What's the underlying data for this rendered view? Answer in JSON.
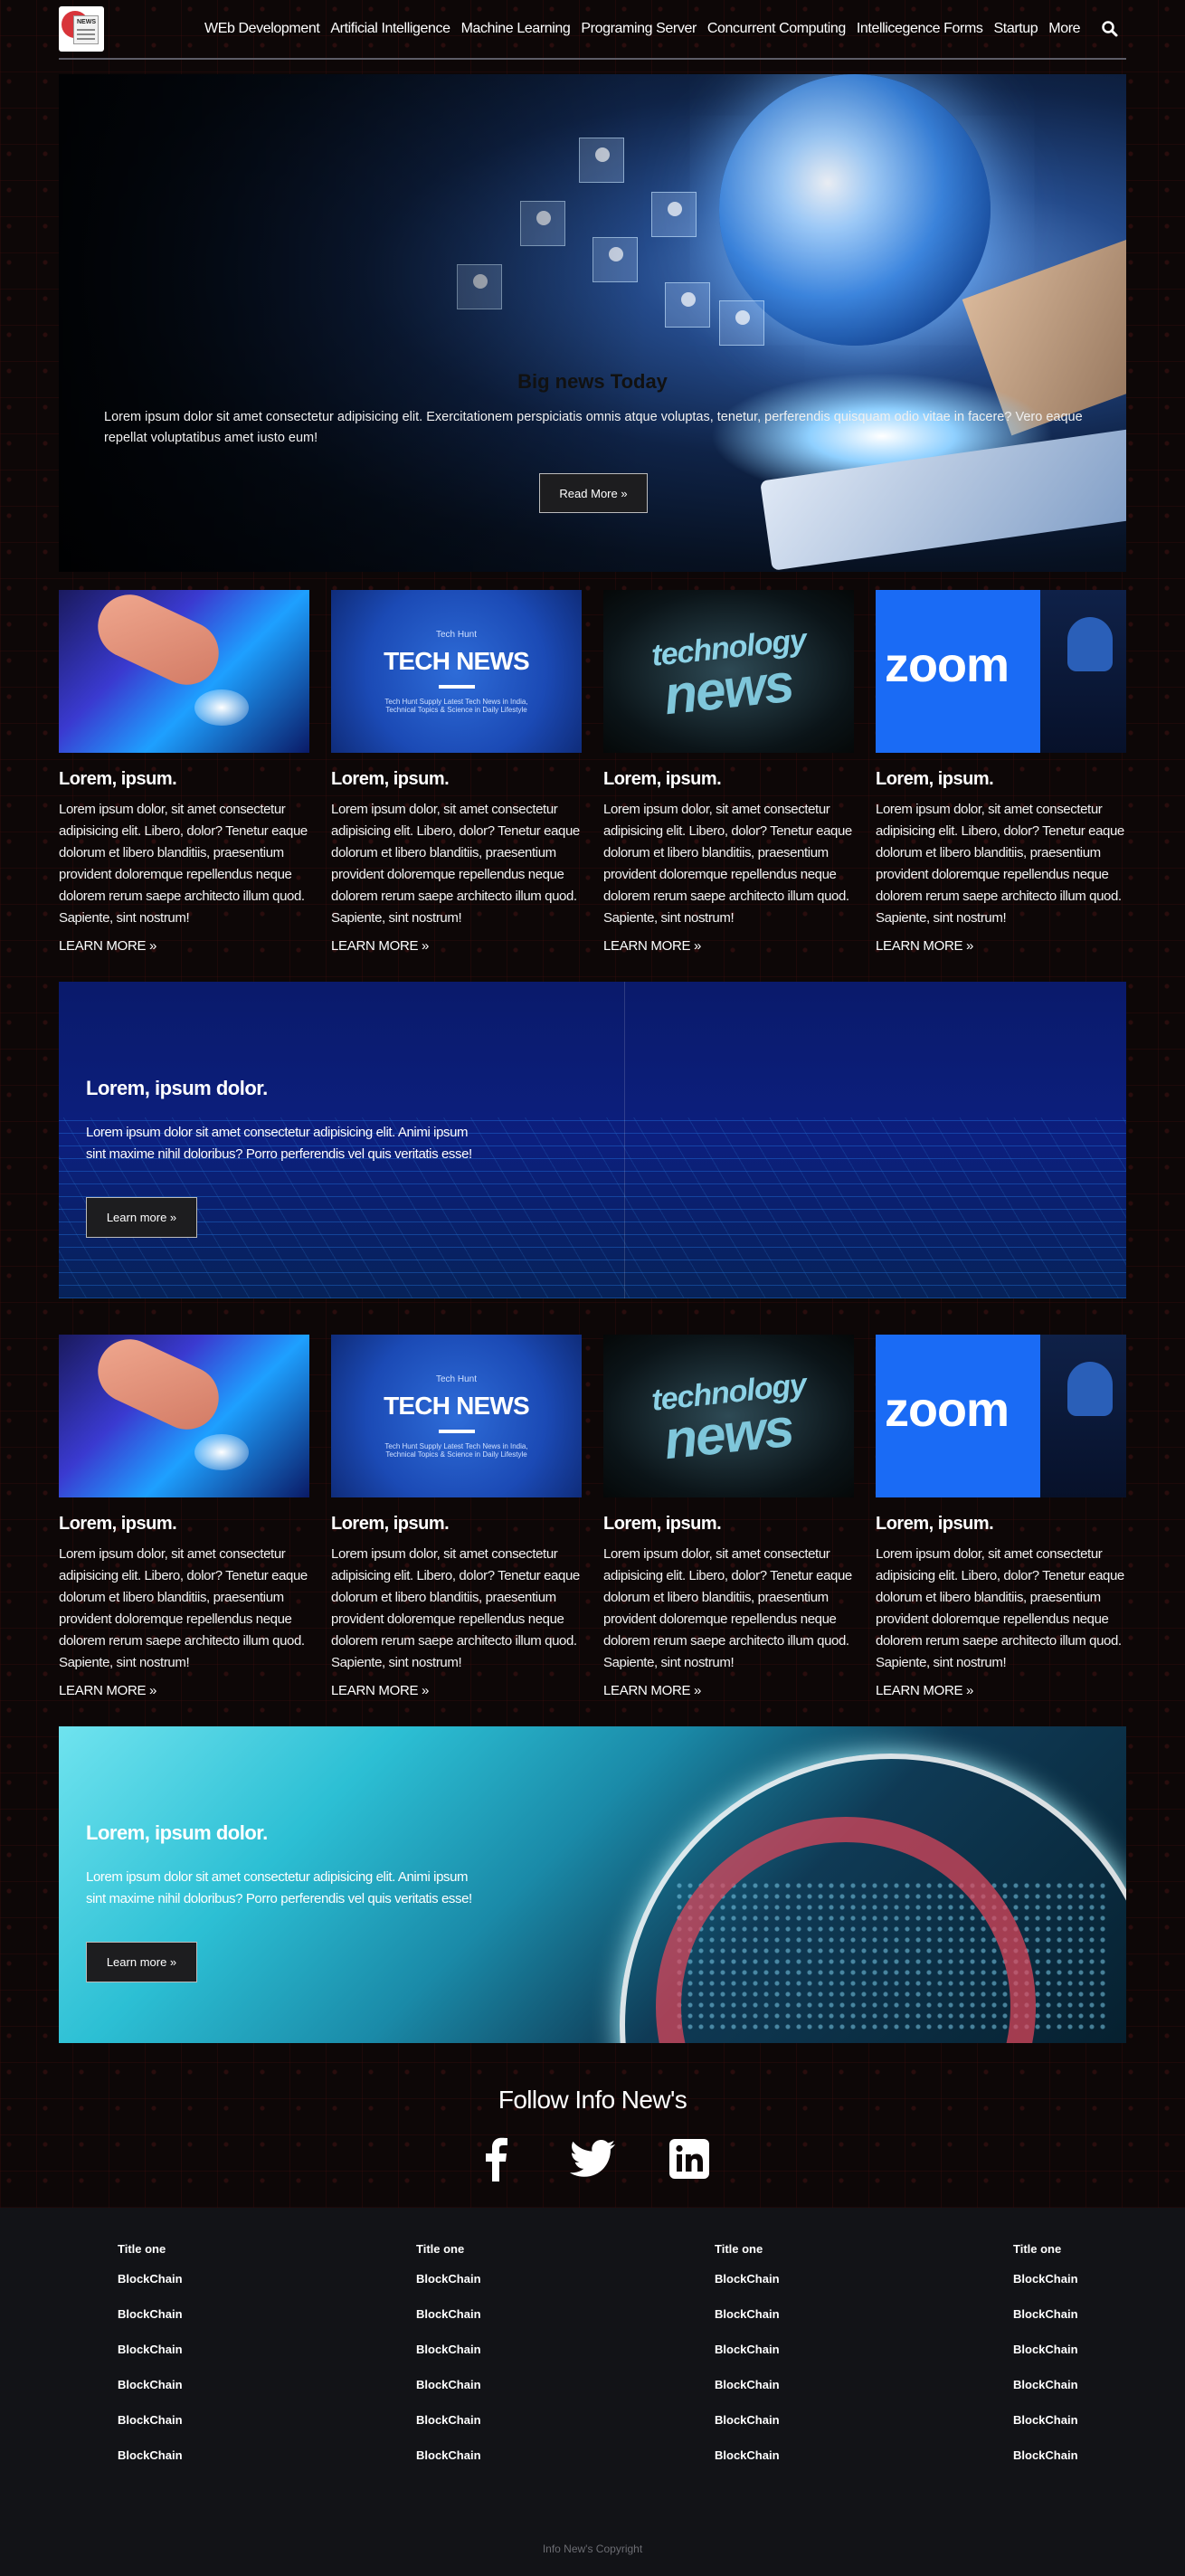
{
  "nav": {
    "logo_text": "NEWS",
    "items": [
      "WEb Development",
      "Artificial Intelligence",
      "Machine Learning",
      "Programing Server",
      "Concurrent Computing",
      "Intellicegence Forms",
      "Startup",
      "More"
    ]
  },
  "hero": {
    "title": "Big news Today",
    "text": "Lorem ipsum dolor sit amet consectetur adipisicing elit. Exercitationem perspiciatis omnis atque voluptas, tenetur, perferendis quisquam odio vitae in facere? Vero eaque repellat voluptatibus amet iusto eum!",
    "button": "Read More »"
  },
  "card_images": {
    "tech_small": "Tech Hunt",
    "tech_big": "TECH NEWS",
    "tech_sub": "Tech Hunt Supply Latest Tech News in India, Technical Topics & Science in Daily Lifestyle",
    "tnews_1": "technology",
    "tnews_2": "news",
    "zoom": "zoom"
  },
  "cards_row1": [
    {
      "title": "Lorem, ipsum.",
      "text": "Lorem ipsum dolor, sit amet consectetur adipisicing elit. Libero, dolor? Tenetur eaque dolorum et libero blanditiis, praesentium provident doloremque repellendus neque dolorem rerum saepe architecto illum quod. Sapiente, sint nostrum!",
      "link": "LEARN MORE »"
    },
    {
      "title": "Lorem, ipsum.",
      "text": "Lorem ipsum dolor, sit amet consectetur adipisicing elit. Libero, dolor? Tenetur eaque dolorum et libero blanditiis, praesentium provident doloremque repellendus neque dolorem rerum saepe architecto illum quod. Sapiente, sint nostrum!",
      "link": "LEARN MORE »"
    },
    {
      "title": "Lorem, ipsum.",
      "text": "Lorem ipsum dolor, sit amet consectetur adipisicing elit. Libero, dolor? Tenetur eaque dolorum et libero blanditiis, praesentium provident doloremque repellendus neque dolorem rerum saepe architecto illum quod. Sapiente, sint nostrum!",
      "link": "LEARN MORE »"
    },
    {
      "title": "Lorem, ipsum.",
      "text": "Lorem ipsum dolor, sit amet consectetur adipisicing elit. Libero, dolor? Tenetur eaque dolorum et libero blanditiis, praesentium provident doloremque repellendus neque dolorem rerum saepe architecto illum quod. Sapiente, sint nostrum!",
      "link": "LEARN MORE »"
    }
  ],
  "banner1": {
    "title": "Lorem, ipsum dolor.",
    "text": "Lorem ipsum dolor sit amet consectetur adipisicing elit. Animi ipsum sint maxime nihil doloribus? Porro perferendis vel quis veritatis esse!",
    "button": "Learn more »"
  },
  "cards_row2": [
    {
      "title": "Lorem, ipsum.",
      "text": "Lorem ipsum dolor, sit amet consectetur adipisicing elit. Libero, dolor? Tenetur eaque dolorum et libero blanditiis, praesentium provident doloremque repellendus neque dolorem rerum saepe architecto illum quod. Sapiente, sint nostrum!",
      "link": "LEARN MORE »"
    },
    {
      "title": "Lorem, ipsum.",
      "text": "Lorem ipsum dolor, sit amet consectetur adipisicing elit. Libero, dolor? Tenetur eaque dolorum et libero blanditiis, praesentium provident doloremque repellendus neque dolorem rerum saepe architecto illum quod. Sapiente, sint nostrum!",
      "link": "LEARN MORE »"
    },
    {
      "title": "Lorem, ipsum.",
      "text": "Lorem ipsum dolor, sit amet consectetur adipisicing elit. Libero, dolor? Tenetur eaque dolorum et libero blanditiis, praesentium provident doloremque repellendus neque dolorem rerum saepe architecto illum quod. Sapiente, sint nostrum!",
      "link": "LEARN MORE »"
    },
    {
      "title": "Lorem, ipsum.",
      "text": "Lorem ipsum dolor, sit amet consectetur adipisicing elit. Libero, dolor? Tenetur eaque dolorum et libero blanditiis, praesentium provident doloremque repellendus neque dolorem rerum saepe architecto illum quod. Sapiente, sint nostrum!",
      "link": "LEARN MORE »"
    }
  ],
  "banner2": {
    "title": "Lorem, ipsum dolor.",
    "text": "Lorem ipsum dolor sit amet consectetur adipisicing elit. Animi ipsum sint maxime nihil doloribus? Porro perferendis vel quis veritatis esse!",
    "button": "Learn more »"
  },
  "follow": {
    "title": "Follow Info New's",
    "icons": [
      "facebook-icon",
      "twitter-icon",
      "linkedin-icon"
    ]
  },
  "footer": {
    "columns": [
      {
        "title": "Title one",
        "links": [
          "BlockChain",
          "BlockChain",
          "BlockChain",
          "BlockChain",
          "BlockChain",
          "BlockChain"
        ]
      },
      {
        "title": "Title one",
        "links": [
          "BlockChain",
          "BlockChain",
          "BlockChain",
          "BlockChain",
          "BlockChain",
          "BlockChain"
        ]
      },
      {
        "title": "Title one",
        "links": [
          "BlockChain",
          "BlockChain",
          "BlockChain",
          "BlockChain",
          "BlockChain",
          "BlockChain"
        ]
      },
      {
        "title": "Title one",
        "links": [
          "BlockChain",
          "BlockChain",
          "BlockChain",
          "BlockChain",
          "BlockChain",
          "BlockChain"
        ]
      }
    ],
    "copyright": "Info New's Copyright"
  }
}
